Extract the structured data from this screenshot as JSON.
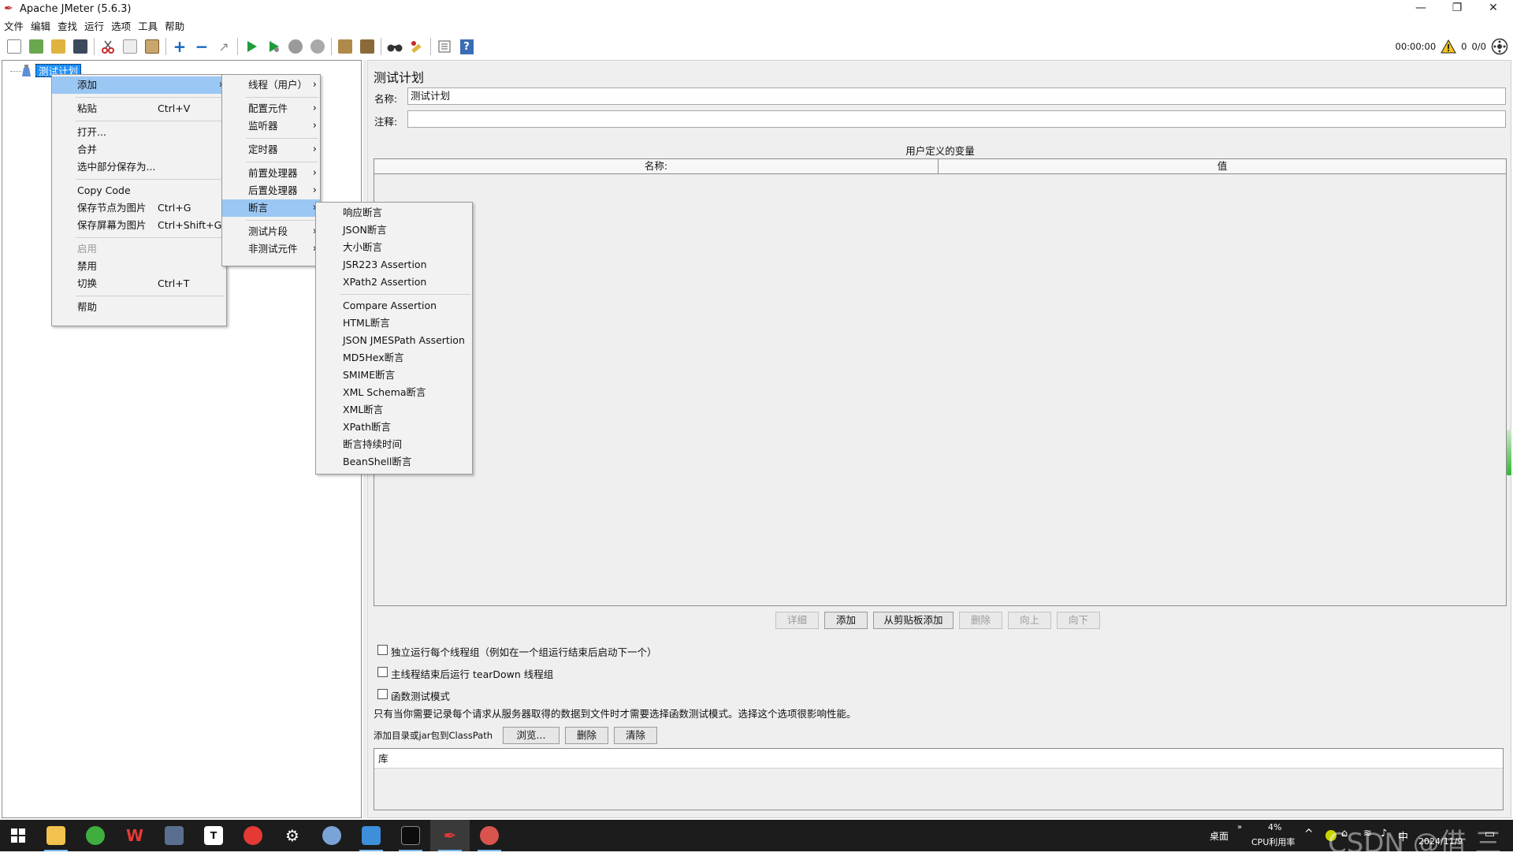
{
  "window": {
    "title": "Apache JMeter (5.6.3)",
    "minimize": "—",
    "restore": "❐",
    "close": "✕"
  },
  "menubar": [
    "文件",
    "编辑",
    "查找",
    "运行",
    "选项",
    "工具",
    "帮助"
  ],
  "toolbar_icons": [
    "new-icon",
    "templates-icon",
    "open-icon",
    "save-icon",
    "cut-icon",
    "copy-icon",
    "paste-icon",
    "expand-icon",
    "collapse-icon",
    "toggle-icon",
    "start-icon",
    "start-no-pause-icon",
    "stop-icon",
    "shutdown-icon",
    "clear-icon",
    "clear-all-icon",
    "search-icon",
    "reset-search-icon",
    "function-helper-icon",
    "help-icon"
  ],
  "status": {
    "timer": "00:00:00",
    "warnings": "0",
    "threads": "0/0"
  },
  "tree": {
    "root_label": "测试计划"
  },
  "context_menu": {
    "add": "添加",
    "paste": "粘贴",
    "paste_sc": "Ctrl+V",
    "open": "打开...",
    "merge": "合并",
    "save_as": "选中部分保存为...",
    "copy_code": "Copy Code",
    "save_node_img": "保存节点为图片",
    "save_node_img_sc": "Ctrl+G",
    "save_screen_img": "保存屏幕为图片",
    "save_screen_img_sc": "Ctrl+Shift+G",
    "enable": "启用",
    "disable": "禁用",
    "toggle": "切换",
    "toggle_sc": "Ctrl+T",
    "help": "帮助"
  },
  "add_menu": {
    "threads": "线程（用户）",
    "config": "配置元件",
    "listener": "监听器",
    "timer": "定时器",
    "pre": "前置处理器",
    "post": "后置处理器",
    "assertions": "断言",
    "fragment": "测试片段",
    "non_test": "非测试元件"
  },
  "assertion_menu": {
    "group1": [
      "响应断言",
      "JSON断言",
      "大小断言",
      "JSR223 Assertion",
      "XPath2 Assertion"
    ],
    "group2": [
      "Compare Assertion",
      "HTML断言",
      "JSON JMESPath Assertion",
      "MD5Hex断言",
      "SMIME断言",
      "XML Schema断言",
      "XML断言",
      "XPath断言",
      "断言持续时间",
      "BeanShell断言"
    ]
  },
  "panel": {
    "title": "测试计划",
    "name_label": "名称:",
    "name_value": "测试计划",
    "comment_label": "注释:",
    "comment_value": "",
    "udv_title": "用户定义的变量",
    "col_name": "名称:",
    "col_value": "值",
    "buttons": {
      "detail": "详细",
      "add": "添加",
      "add_clipboard": "从剪贴板添加",
      "delete": "删除",
      "up": "向上",
      "down": "向下"
    },
    "cb_serialize": "独立运行每个线程组（例如在一个组运行结束后启动下一个）",
    "cb_teardown": "主线程结束后运行 tearDown 线程组",
    "cb_functional": "函数测试模式",
    "functional_note": "只有当你需要记录每个请求从服务器取得的数据到文件时才需要选择函数测试模式。选择这个选项很影响性能。",
    "classpath_label": "添加目录或jar包到ClassPath",
    "browse": "浏览...",
    "cp_delete": "删除",
    "cp_clear": "清除",
    "lib_header": "库"
  },
  "taskbar": {
    "apps": [
      "windows-start-icon",
      "file-explorer-icon",
      "browser-icon",
      "wps-icon",
      "camera-icon",
      "typora-icon",
      "netease-music-icon",
      "settings-icon",
      "ide-icon",
      "file-manager-icon",
      "terminal-icon",
      "jmeter-icon",
      "app-icon"
    ],
    "desktop": "桌面",
    "cpu_pct": "4%",
    "cpu_label": "CPU利用率",
    "ime": "中",
    "date": "2024/11/9",
    "watermark": "CSDN @借 三"
  },
  "colors": {
    "selection": "#1e90ff",
    "menu_highlight": "#9ac7f3",
    "taskbar": "#1c1c1c"
  }
}
